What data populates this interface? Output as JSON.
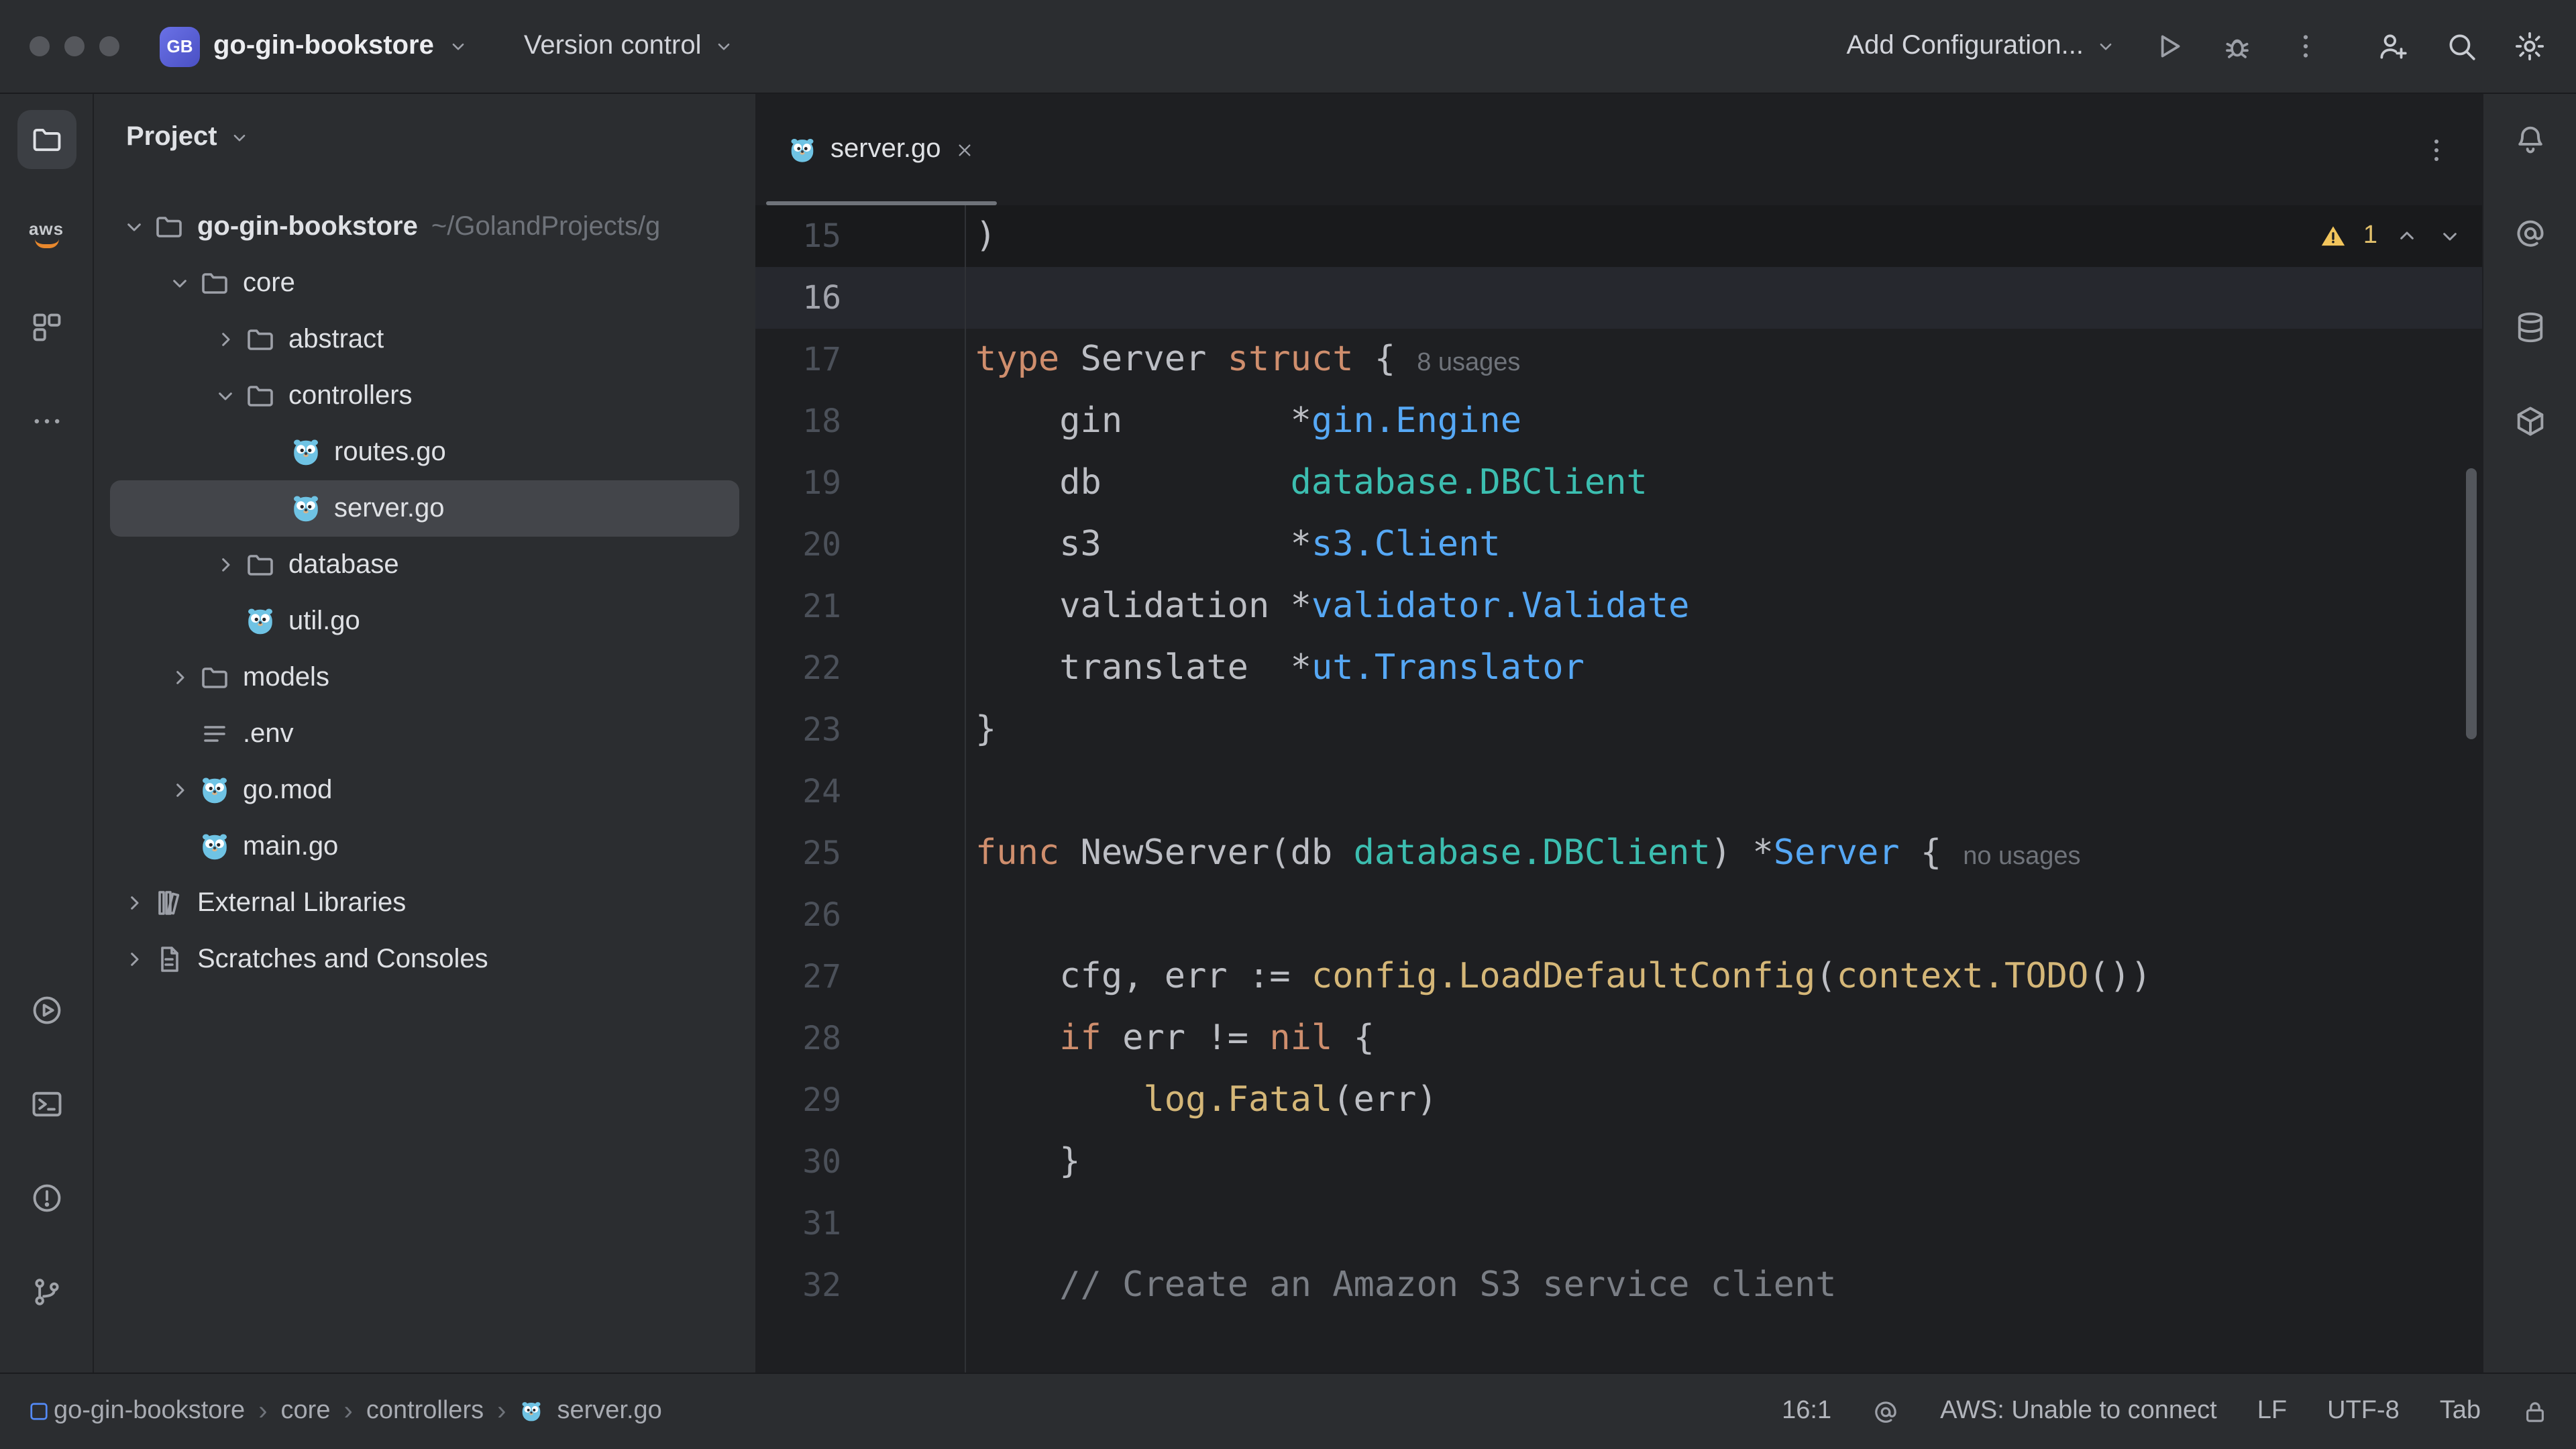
{
  "palette": {
    "panel": "#2b2d30",
    "editor_bg": "#1e1f22",
    "selection": "#43454a",
    "caret_line": "#26282e",
    "badge_accent": "#5a61d6",
    "warning_yellow": "#f2c55c",
    "gopher_blue": "#6fc3e4",
    "aws_orange": "#e8882d"
  },
  "titlebar": {
    "badge": "GB",
    "project_name": "go-gin-bookstore",
    "vcs_widget": "Version control",
    "add_configuration": "Add Configuration...",
    "action_icons": [
      "run",
      "debug",
      "more"
    ],
    "tool_icons": [
      "add-user",
      "search",
      "settings"
    ]
  },
  "left_rail": {
    "top": [
      "project",
      "aws",
      "structure",
      "more-horizontal"
    ],
    "active": "project",
    "bottom": [
      "run-circle",
      "terminal",
      "problems",
      "git-branch"
    ]
  },
  "right_rail": [
    "notifications",
    "ai-assistant",
    "database",
    "dependencies"
  ],
  "project_panel": {
    "title": "Project",
    "tree": [
      {
        "label": "go-gin-bookstore",
        "suffix": "~/GolandProjects/g",
        "icon": "folder",
        "chevron": "down",
        "level": 0,
        "bold": true
      },
      {
        "label": "core",
        "icon": "folder",
        "chevron": "down",
        "level": 1
      },
      {
        "label": "abstract",
        "icon": "folder",
        "chevron": "right",
        "level": 2
      },
      {
        "label": "controllers",
        "icon": "folder",
        "chevron": "down",
        "level": 2
      },
      {
        "label": "routes.go",
        "icon": "go",
        "level": 3
      },
      {
        "label": "server.go",
        "icon": "go",
        "level": 3,
        "selected": true
      },
      {
        "label": "database",
        "icon": "folder",
        "chevron": "right",
        "level": 2
      },
      {
        "label": "util.go",
        "icon": "go",
        "level": 2
      },
      {
        "label": "models",
        "icon": "folder",
        "chevron": "right",
        "level": 1
      },
      {
        "label": ".env",
        "icon": "list",
        "level": 1
      },
      {
        "label": "go.mod",
        "icon": "go",
        "chevron": "right",
        "level": 1
      },
      {
        "label": "main.go",
        "icon": "go",
        "level": 1
      },
      {
        "label": "External Libraries",
        "icon": "libraries",
        "chevron": "right",
        "level": 0
      },
      {
        "label": "Scratches and Consoles",
        "icon": "scratches",
        "chevron": "right",
        "level": 0
      }
    ]
  },
  "editor": {
    "tab": {
      "icon": "go",
      "label": "server.go"
    },
    "inspection": {
      "warning_count": "1"
    },
    "lines": [
      {
        "n": 15,
        "band": true,
        "tokens": [
          [
            ")",
            "d"
          ]
        ]
      },
      {
        "n": 16,
        "caret": true,
        "tokens": []
      },
      {
        "n": 17,
        "tokens": [
          [
            "type",
            "k"
          ],
          [
            " Server ",
            "d"
          ],
          [
            "struct",
            "k"
          ],
          [
            " {",
            "d"
          ]
        ],
        "inlay": "8 usages"
      },
      {
        "n": 18,
        "tokens": [
          [
            "    gin        ",
            "d"
          ],
          [
            "*",
            "d"
          ],
          [
            "gin.Engine",
            "t"
          ]
        ]
      },
      {
        "n": 19,
        "tokens": [
          [
            "    db         ",
            "d"
          ],
          [
            "database.DBClient",
            "i"
          ]
        ]
      },
      {
        "n": 20,
        "tokens": [
          [
            "    s3         ",
            "d"
          ],
          [
            "*",
            "d"
          ],
          [
            "s3.Client",
            "t"
          ]
        ]
      },
      {
        "n": 21,
        "tokens": [
          [
            "    validation ",
            "d"
          ],
          [
            "*",
            "d"
          ],
          [
            "validator.Validate",
            "t"
          ]
        ]
      },
      {
        "n": 22,
        "tokens": [
          [
            "    translate  ",
            "d"
          ],
          [
            "*",
            "d"
          ],
          [
            "ut.Translator",
            "t"
          ]
        ]
      },
      {
        "n": 23,
        "tokens": [
          [
            "}",
            "d"
          ]
        ]
      },
      {
        "n": 24,
        "tokens": []
      },
      {
        "n": 25,
        "tokens": [
          [
            "func",
            "k"
          ],
          [
            " NewServer(db ",
            "d"
          ],
          [
            "database.DBClient",
            "i"
          ],
          [
            ") ",
            "d"
          ],
          [
            "*",
            "d"
          ],
          [
            "Server",
            "t"
          ],
          [
            " {",
            "d"
          ]
        ],
        "inlay": "no usages"
      },
      {
        "n": 26,
        "tokens": []
      },
      {
        "n": 27,
        "tokens": [
          [
            "    cfg, err := ",
            "d"
          ],
          [
            "config.LoadDefaultConfig",
            "f"
          ],
          [
            "(",
            "d"
          ],
          [
            "context.TODO",
            "f"
          ],
          [
            "())",
            "d"
          ]
        ]
      },
      {
        "n": 28,
        "tokens": [
          [
            "    ",
            "d"
          ],
          [
            "if",
            "k"
          ],
          [
            " err != ",
            "d"
          ],
          [
            "nil",
            "k"
          ],
          [
            " {",
            "d"
          ]
        ]
      },
      {
        "n": 29,
        "tokens": [
          [
            "        ",
            "d"
          ],
          [
            "log.Fatal",
            "f"
          ],
          [
            "(err)",
            "d"
          ]
        ]
      },
      {
        "n": 30,
        "tokens": [
          [
            "    }",
            "d"
          ]
        ]
      },
      {
        "n": 31,
        "tokens": []
      },
      {
        "n": 32,
        "tokens": [
          [
            "    ",
            "d"
          ],
          [
            "// Create an Amazon S3 service client",
            "c"
          ]
        ]
      }
    ]
  },
  "statusbar": {
    "breadcrumbs": [
      "go-gin-bookstore",
      "core",
      "controllers",
      "server.go"
    ],
    "caret_position": "16:1",
    "aws_status": "AWS: Unable to connect",
    "line_separator": "LF",
    "encoding": "UTF-8",
    "indent_style": "Tab"
  }
}
